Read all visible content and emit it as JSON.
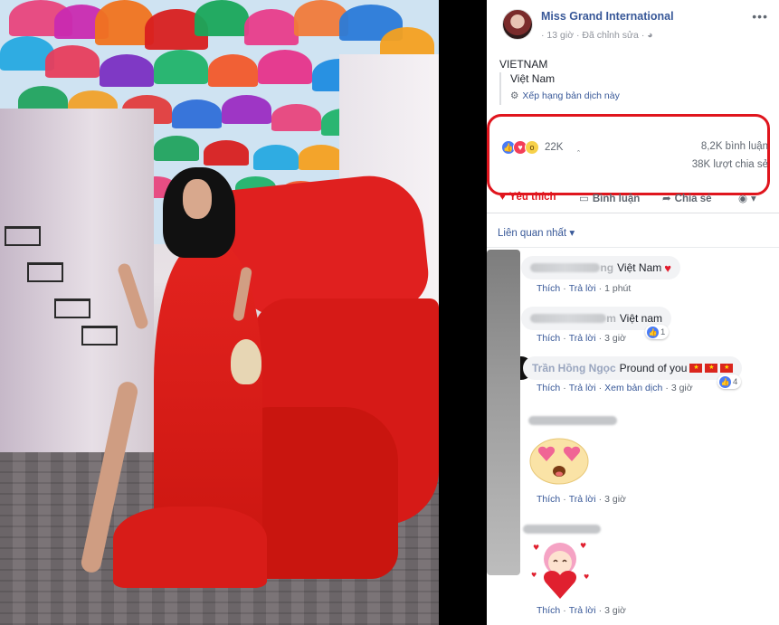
{
  "post": {
    "page_name": "Miss Grand International",
    "meta_time": "13 giờ",
    "meta_edited": "Đã chỉnh sửa",
    "text": "VIETNAM",
    "translation": "Việt Nam",
    "rate_translation": "Xếp hạng bản dịch này",
    "reaction_count": "22K",
    "comments_count": "8,2K bình luận",
    "shares_count": "38K lượt chia sẻ"
  },
  "actions": {
    "like": "Yêu thích",
    "comment": "Bình luận",
    "share": "Chia sẻ"
  },
  "sort": {
    "label": "Liên quan nhất"
  },
  "comments": [
    {
      "name_tail": "ng",
      "text": "Việt Nam",
      "like": "Thích",
      "reply": "Trả lời",
      "time": "1 phút"
    },
    {
      "name_tail": "m",
      "text": "Việt nam",
      "like": "Thích",
      "reply": "Trả lời",
      "time": "3 giờ",
      "likes": "1"
    },
    {
      "name": "Trần Hồng Ngọc",
      "text": "Pround of you",
      "like": "Thích",
      "reply": "Trả lời",
      "see_translation": "Xem bản dịch",
      "time": "3 giờ",
      "likes": "4"
    },
    {
      "like": "Thích",
      "reply": "Trả lời",
      "time": "3 giờ"
    },
    {
      "like": "Thích",
      "reply": "Trả lời",
      "time": "3 giờ"
    }
  ],
  "colors": {
    "link": "#385898",
    "highlight_box": "#e0151d",
    "dress": "#e0201f"
  },
  "icons": {
    "like": "thumbs-up-icon",
    "love": "heart-icon",
    "wow": "wow-icon",
    "more": "more-dots-icon",
    "globe": "globe-icon",
    "gear": "gear-icon"
  }
}
